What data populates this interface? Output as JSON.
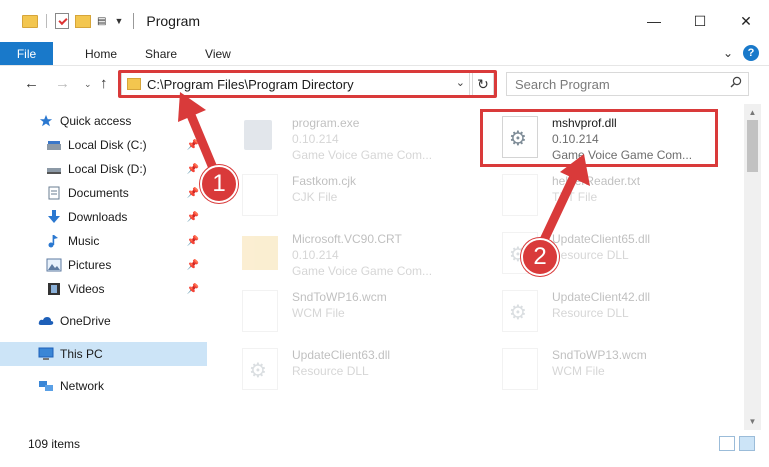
{
  "titlebar": {
    "title": "Program",
    "minimize": "—",
    "maximize": "☐",
    "close": "✕"
  },
  "ribbon": {
    "tabs": [
      "File",
      "Home",
      "Share",
      "View"
    ],
    "expand": "⌄",
    "help": "?"
  },
  "nav": {
    "back": "←",
    "forward": "→",
    "recent": "⌄",
    "up": "↑",
    "address": "C:\\Program Files\\Program Directory",
    "address_dropdown": "⌄",
    "refresh": "↻",
    "search_placeholder": "Search Program"
  },
  "sidebar": {
    "items": [
      {
        "label": "Quick access",
        "icon": "star-icon",
        "pinned": false
      },
      {
        "label": "Local Disk (C:)",
        "icon": "drive-icon",
        "pinned": true
      },
      {
        "label": "Local Disk (D:)",
        "icon": "drive-icon",
        "pinned": true
      },
      {
        "label": "Documents",
        "icon": "documents-icon",
        "pinned": true
      },
      {
        "label": "Downloads",
        "icon": "downloads-icon",
        "pinned": true
      },
      {
        "label": "Music",
        "icon": "music-icon",
        "pinned": true
      },
      {
        "label": "Pictures",
        "icon": "pictures-icon",
        "pinned": true
      },
      {
        "label": "Videos",
        "icon": "videos-icon",
        "pinned": true
      },
      {
        "label": "OneDrive",
        "icon": "cloud-icon",
        "pinned": false
      },
      {
        "label": "This PC",
        "icon": "pc-icon",
        "pinned": false,
        "selected": true
      },
      {
        "label": "Network",
        "icon": "network-icon",
        "pinned": false
      }
    ]
  },
  "files": [
    {
      "name": "program.exe",
      "line2": "0.10.214",
      "line3": "Game Voice Game Com...",
      "type": "exe"
    },
    {
      "name": "mshvprof.dll",
      "line2": "0.10.214",
      "line3": "Game Voice Game Com...",
      "type": "dll",
      "highlighted": true
    },
    {
      "name": "Fastkom.cjk",
      "line2": "CJK File",
      "line3": "",
      "type": "txt"
    },
    {
      "name": "helperReader.txt",
      "line2": "TXT File",
      "line3": "",
      "type": "txt"
    },
    {
      "name": "Microsoft.VC90.CRT",
      "line2": "0.10.214",
      "line3": "Game Voice Game Com...",
      "type": "folder"
    },
    {
      "name": "UpdateClient65.dll",
      "line2": "Resource DLL",
      "line3": "",
      "type": "dll"
    },
    {
      "name": "SndToWP16.wcm",
      "line2": "WCM File",
      "line3": "",
      "type": "txt"
    },
    {
      "name": "UpdateClient42.dll",
      "line2": "Resource DLL",
      "line3": "",
      "type": "dll"
    },
    {
      "name": "UpdateClient63.dll",
      "line2": "Resource DLL",
      "line3": "",
      "type": "dll"
    },
    {
      "name": "SndToWP13.wcm",
      "line2": "WCM File",
      "line3": "",
      "type": "txt"
    }
  ],
  "status": {
    "items_count": "109 items"
  },
  "callouts": [
    "1",
    "2"
  ],
  "colors": {
    "accent": "#1979ca",
    "highlight": "#d93a3a",
    "selected_bg": "#cce4f7"
  }
}
